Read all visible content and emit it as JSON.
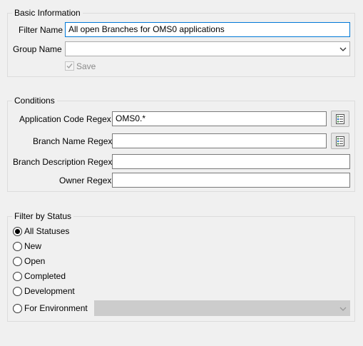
{
  "basic_info": {
    "legend": "Basic Information",
    "filter_name_label": "Filter Name",
    "filter_name_value": "All open Branches for OMS0 applications",
    "group_name_label": "Group Name",
    "group_name_value": "",
    "save_label": "Save",
    "save_checked": true
  },
  "conditions": {
    "legend": "Conditions",
    "app_code_label": "Application Code Regex",
    "app_code_value": "OMS0.*",
    "branch_name_label": "Branch Name Regex",
    "branch_name_value": "",
    "branch_desc_label": "Branch Description Regex",
    "branch_desc_value": "",
    "owner_label": "Owner Regex",
    "owner_value": "",
    "picker_icon": "list-picker-icon"
  },
  "status": {
    "legend": "Filter by Status",
    "options": [
      {
        "label": "All Statuses",
        "checked": true
      },
      {
        "label": "New",
        "checked": false
      },
      {
        "label": "Open",
        "checked": false
      },
      {
        "label": "Completed",
        "checked": false
      },
      {
        "label": "Development",
        "checked": false
      },
      {
        "label": "For Environment",
        "checked": false
      }
    ],
    "environment_value": ""
  },
  "colors": {
    "background": "#f0f0f0",
    "focus_border": "#0078d7",
    "group_border": "#dcdcdc"
  }
}
